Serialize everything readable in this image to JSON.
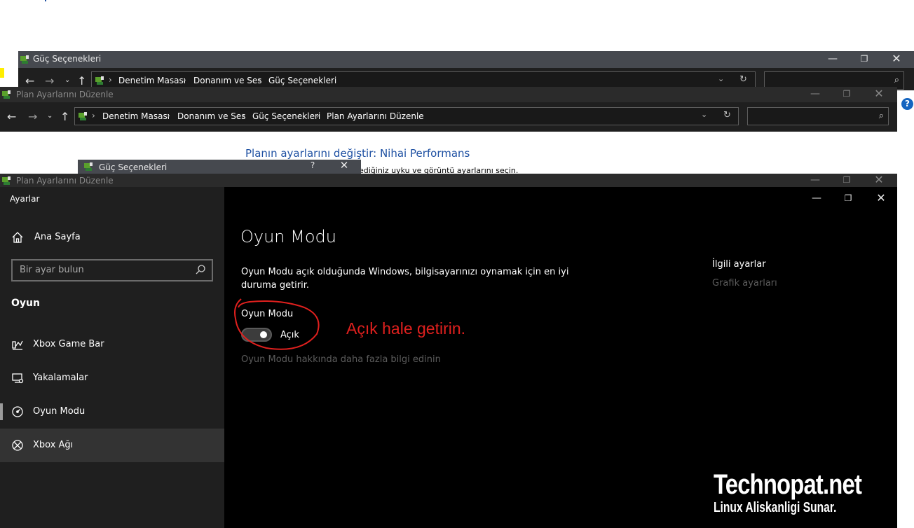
{
  "window_back": {
    "title": "Güç Seçenekleri",
    "breadcrumb": [
      "Denetim Masası",
      "Donanım ve Ses",
      "Güç Seçenekleri"
    ]
  },
  "window_mid": {
    "title": "Plan Ayarlarını Düzenle",
    "breadcrumb": [
      "Denetim Masası",
      "Donanım ve Ses",
      "Güç Seçenekleri",
      "Plan Ayarlarını Düzenle"
    ]
  },
  "control_panel": {
    "plan_title": "Planın ayarlarını değiştir: Nihai Performans",
    "plan_subtitle": "ediğiniz uyku ve görüntü ayarlarını seçin.",
    "dialog_title": "Güç Seçenekleri",
    "dialog_help": "?",
    "help_icon": "?"
  },
  "window_front": {
    "title": "Plan Ayarlarını Düzenle"
  },
  "settings": {
    "app_title": "Ayarlar",
    "home_label": "Ana Sayfa",
    "search_placeholder": "Bir ayar bulun",
    "section_label": "Oyun",
    "nav_items": [
      {
        "label": "Xbox Game Bar",
        "icon": "game-bar-icon"
      },
      {
        "label": "Yakalamalar",
        "icon": "capture-icon"
      },
      {
        "label": "Oyun Modu",
        "icon": "game-mode-icon"
      },
      {
        "label": "Xbox Ağı",
        "icon": "xbox-icon"
      }
    ],
    "page_title": "Oyun Modu",
    "description": "Oyun Modu açık olduğunda Windows, bilgisayarınızı oynamak için en iyi duruma getirir.",
    "option_label": "Oyun Modu",
    "toggle_state": "Açık",
    "toggle_on": true,
    "learn_more": "Oyun Modu hakkında daha fazla bilgi edinin",
    "related_title": "İlgili ayarlar",
    "related_link": "Grafik ayarları"
  },
  "annotation": {
    "text": "Açık hale getirin.",
    "color": "#e0201e"
  },
  "watermark": {
    "brand": "Technopat.net",
    "tagline": "Linux Aliskanligi Sunar."
  },
  "colors": {
    "link_blue": "#1e50a2",
    "sidebar_bg": "#1f1f1f",
    "content_bg": "#000000",
    "selected_bg": "#333333"
  }
}
